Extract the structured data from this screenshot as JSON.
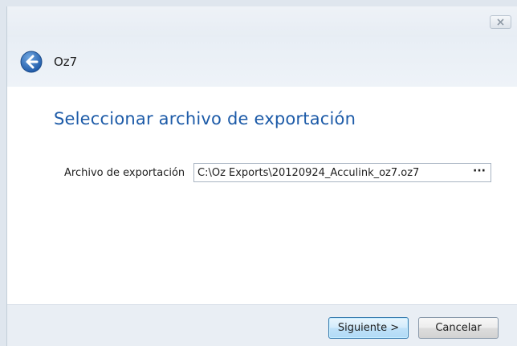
{
  "window": {
    "close_icon": "close-icon"
  },
  "header": {
    "back_icon": "back-arrow-icon",
    "title": "Oz7"
  },
  "main": {
    "page_title": "Seleccionar archivo de exportación",
    "export_file": {
      "label": "Archivo de exportación",
      "value": "C:\\Oz Exports\\20120924_Acculink_oz7.oz7",
      "browse_label": "···"
    }
  },
  "footer": {
    "next_label": "Siguiente >",
    "cancel_label": "Cancelar"
  },
  "colors": {
    "accent_title": "#1d5ba8",
    "back_button": "#2d6fb8"
  }
}
